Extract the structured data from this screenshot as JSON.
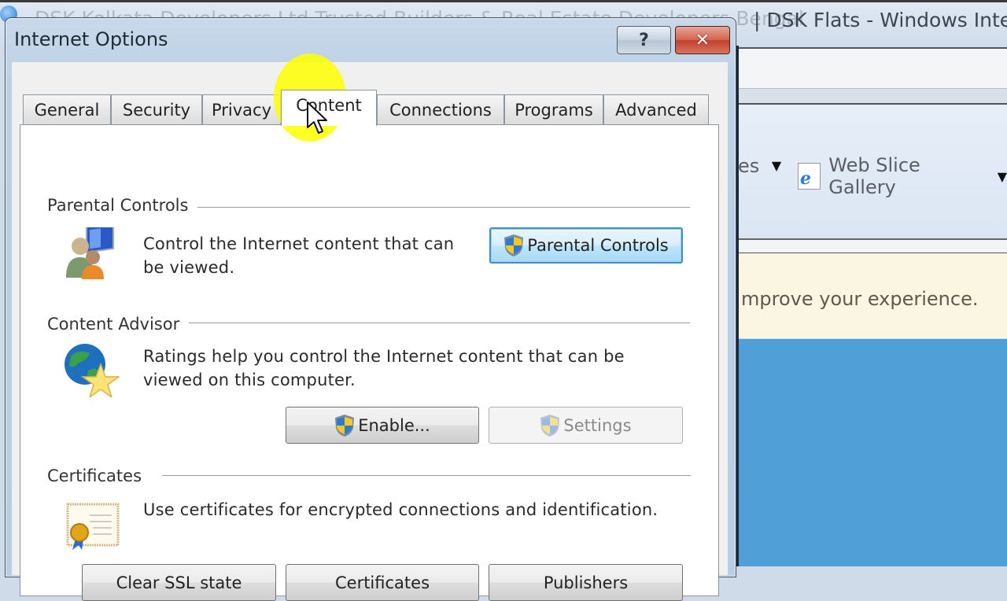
{
  "background_window": {
    "title_visible": "| DSK Flats - Windows Intern",
    "title_occluded": "DSK Kolkata Developers Ltd Trusted Builders & Real Estate Developers Bengal",
    "favorites_bar": {
      "partial_item": "es",
      "web_slice_gallery": "Web Slice Gallery"
    },
    "info_bar_text": "mprove your experience.",
    "page_background": "#509fd6"
  },
  "dialog": {
    "title": "Internet Options",
    "help_button": "?",
    "close_button": "✕",
    "tabs": [
      {
        "label": "General",
        "active": false
      },
      {
        "label": "Security",
        "active": false
      },
      {
        "label": "Privacy",
        "active": false
      },
      {
        "label": "Content",
        "active": true
      },
      {
        "label": "Connections",
        "active": false
      },
      {
        "label": "Programs",
        "active": false
      },
      {
        "label": "Advanced",
        "active": false
      }
    ],
    "parental_controls": {
      "heading": "Parental Controls",
      "description_line1": "Control the Internet content that can",
      "description_line2": "be viewed.",
      "button": "Parental Controls"
    },
    "content_advisor": {
      "heading": "Content Advisor",
      "description_line1": "Ratings help you control the Internet content that can be",
      "description_line2": "viewed on this computer.",
      "enable_button": "Enable...",
      "settings_button": "Settings",
      "settings_enabled": false
    },
    "certificates": {
      "heading": "Certificates",
      "description": "Use certificates for encrypted connections and identification.",
      "buttons": [
        "Clear SSL state",
        "Certificates",
        "Publishers"
      ]
    }
  },
  "colors": {
    "highlight": "#ffff00",
    "default_button_border": "#3c8fc8",
    "close_button": "#c0402c"
  }
}
